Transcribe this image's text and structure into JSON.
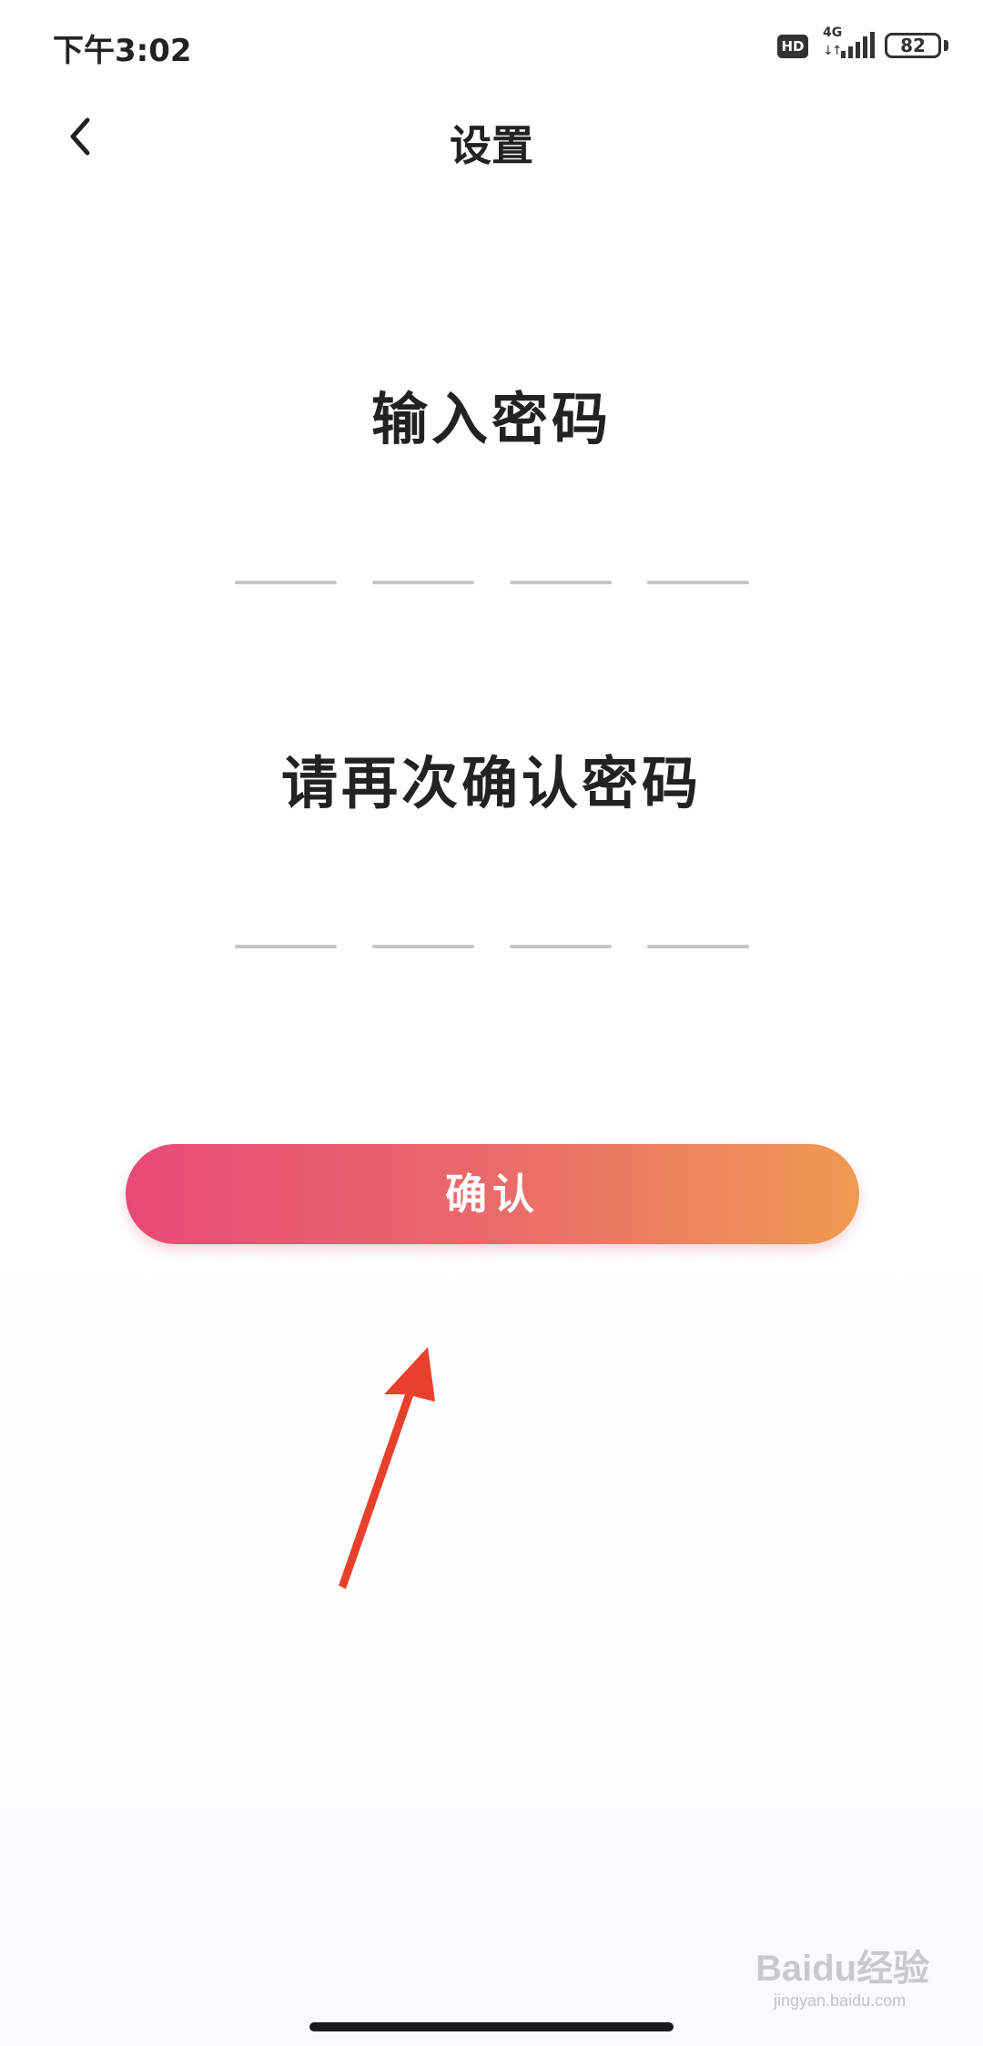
{
  "status_bar": {
    "time": "下午3:02",
    "hd_label": "HD",
    "network_label": "4G",
    "battery_level": "82"
  },
  "nav": {
    "title": "设置"
  },
  "password_entry": {
    "title": "输入密码",
    "digit_count": 4
  },
  "password_confirm": {
    "title": "请再次确认密码",
    "digit_count": 4
  },
  "confirm_button": {
    "label": "确认",
    "gradient_start": "#e84a77",
    "gradient_end": "#ef9a52"
  },
  "annotation": {
    "arrow_color": "#e8402c"
  },
  "watermark": {
    "main": "Baidu经验",
    "sub": "jingyan.baidu.com"
  }
}
